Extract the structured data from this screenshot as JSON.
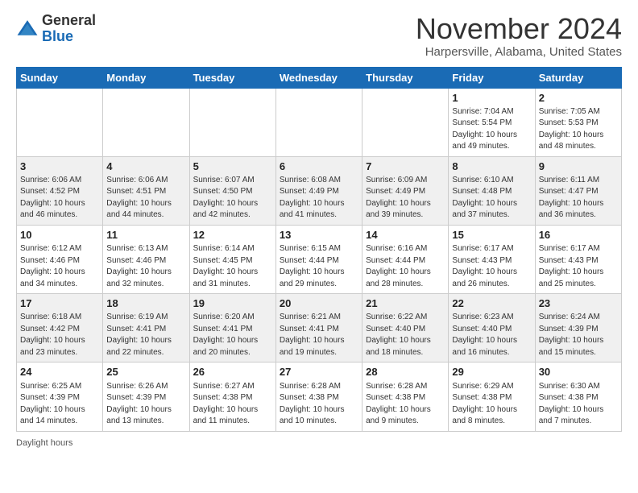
{
  "header": {
    "logo_general": "General",
    "logo_blue": "Blue",
    "month_title": "November 2024",
    "location": "Harpersville, Alabama, United States"
  },
  "days_of_week": [
    "Sunday",
    "Monday",
    "Tuesday",
    "Wednesday",
    "Thursday",
    "Friday",
    "Saturday"
  ],
  "weeks": [
    [
      {
        "day": "",
        "info": ""
      },
      {
        "day": "",
        "info": ""
      },
      {
        "day": "",
        "info": ""
      },
      {
        "day": "",
        "info": ""
      },
      {
        "day": "",
        "info": ""
      },
      {
        "day": "1",
        "info": "Sunrise: 7:04 AM\nSunset: 5:54 PM\nDaylight: 10 hours and 49 minutes."
      },
      {
        "day": "2",
        "info": "Sunrise: 7:05 AM\nSunset: 5:53 PM\nDaylight: 10 hours and 48 minutes."
      }
    ],
    [
      {
        "day": "3",
        "info": "Sunrise: 6:06 AM\nSunset: 4:52 PM\nDaylight: 10 hours and 46 minutes."
      },
      {
        "day": "4",
        "info": "Sunrise: 6:06 AM\nSunset: 4:51 PM\nDaylight: 10 hours and 44 minutes."
      },
      {
        "day": "5",
        "info": "Sunrise: 6:07 AM\nSunset: 4:50 PM\nDaylight: 10 hours and 42 minutes."
      },
      {
        "day": "6",
        "info": "Sunrise: 6:08 AM\nSunset: 4:49 PM\nDaylight: 10 hours and 41 minutes."
      },
      {
        "day": "7",
        "info": "Sunrise: 6:09 AM\nSunset: 4:49 PM\nDaylight: 10 hours and 39 minutes."
      },
      {
        "day": "8",
        "info": "Sunrise: 6:10 AM\nSunset: 4:48 PM\nDaylight: 10 hours and 37 minutes."
      },
      {
        "day": "9",
        "info": "Sunrise: 6:11 AM\nSunset: 4:47 PM\nDaylight: 10 hours and 36 minutes."
      }
    ],
    [
      {
        "day": "10",
        "info": "Sunrise: 6:12 AM\nSunset: 4:46 PM\nDaylight: 10 hours and 34 minutes."
      },
      {
        "day": "11",
        "info": "Sunrise: 6:13 AM\nSunset: 4:46 PM\nDaylight: 10 hours and 32 minutes."
      },
      {
        "day": "12",
        "info": "Sunrise: 6:14 AM\nSunset: 4:45 PM\nDaylight: 10 hours and 31 minutes."
      },
      {
        "day": "13",
        "info": "Sunrise: 6:15 AM\nSunset: 4:44 PM\nDaylight: 10 hours and 29 minutes."
      },
      {
        "day": "14",
        "info": "Sunrise: 6:16 AM\nSunset: 4:44 PM\nDaylight: 10 hours and 28 minutes."
      },
      {
        "day": "15",
        "info": "Sunrise: 6:17 AM\nSunset: 4:43 PM\nDaylight: 10 hours and 26 minutes."
      },
      {
        "day": "16",
        "info": "Sunrise: 6:17 AM\nSunset: 4:43 PM\nDaylight: 10 hours and 25 minutes."
      }
    ],
    [
      {
        "day": "17",
        "info": "Sunrise: 6:18 AM\nSunset: 4:42 PM\nDaylight: 10 hours and 23 minutes."
      },
      {
        "day": "18",
        "info": "Sunrise: 6:19 AM\nSunset: 4:41 PM\nDaylight: 10 hours and 22 minutes."
      },
      {
        "day": "19",
        "info": "Sunrise: 6:20 AM\nSunset: 4:41 PM\nDaylight: 10 hours and 20 minutes."
      },
      {
        "day": "20",
        "info": "Sunrise: 6:21 AM\nSunset: 4:41 PM\nDaylight: 10 hours and 19 minutes."
      },
      {
        "day": "21",
        "info": "Sunrise: 6:22 AM\nSunset: 4:40 PM\nDaylight: 10 hours and 18 minutes."
      },
      {
        "day": "22",
        "info": "Sunrise: 6:23 AM\nSunset: 4:40 PM\nDaylight: 10 hours and 16 minutes."
      },
      {
        "day": "23",
        "info": "Sunrise: 6:24 AM\nSunset: 4:39 PM\nDaylight: 10 hours and 15 minutes."
      }
    ],
    [
      {
        "day": "24",
        "info": "Sunrise: 6:25 AM\nSunset: 4:39 PM\nDaylight: 10 hours and 14 minutes."
      },
      {
        "day": "25",
        "info": "Sunrise: 6:26 AM\nSunset: 4:39 PM\nDaylight: 10 hours and 13 minutes."
      },
      {
        "day": "26",
        "info": "Sunrise: 6:27 AM\nSunset: 4:38 PM\nDaylight: 10 hours and 11 minutes."
      },
      {
        "day": "27",
        "info": "Sunrise: 6:28 AM\nSunset: 4:38 PM\nDaylight: 10 hours and 10 minutes."
      },
      {
        "day": "28",
        "info": "Sunrise: 6:28 AM\nSunset: 4:38 PM\nDaylight: 10 hours and 9 minutes."
      },
      {
        "day": "29",
        "info": "Sunrise: 6:29 AM\nSunset: 4:38 PM\nDaylight: 10 hours and 8 minutes."
      },
      {
        "day": "30",
        "info": "Sunrise: 6:30 AM\nSunset: 4:38 PM\nDaylight: 10 hours and 7 minutes."
      }
    ]
  ],
  "footer": {
    "note": "Daylight hours"
  }
}
